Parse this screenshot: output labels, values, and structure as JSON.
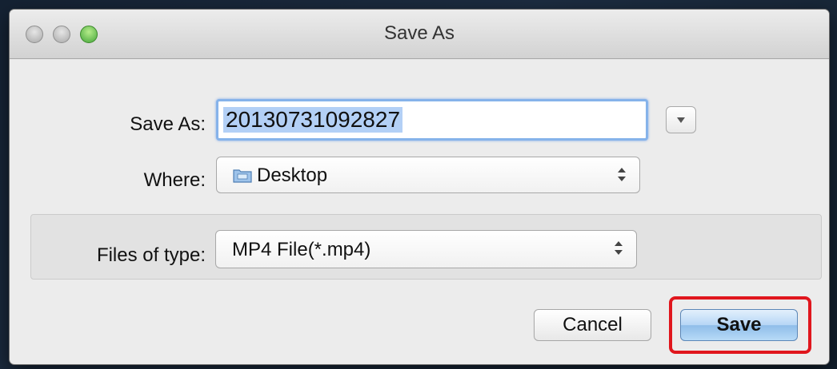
{
  "window": {
    "title": "Save As"
  },
  "form": {
    "saveas_label": "Save As:",
    "saveas_value": "20130731092827",
    "where_label": "Where:",
    "where_value": "Desktop",
    "filetype_label": "Files of type:",
    "filetype_value": "MP4 File(*.mp4)"
  },
  "buttons": {
    "cancel_label": "Cancel",
    "save_label": "Save"
  },
  "icons": {
    "close": "close-icon",
    "minimize": "minimize-icon",
    "zoom": "zoom-icon",
    "expand": "chevron-down-icon",
    "folder": "folder-icon",
    "popup_arrows": "updown-arrows-icon"
  },
  "colors": {
    "highlight": "#e0161d",
    "selection": "#b3d0f6",
    "focus_ring": "#86b3ea",
    "default_button": "#8fbde9"
  }
}
